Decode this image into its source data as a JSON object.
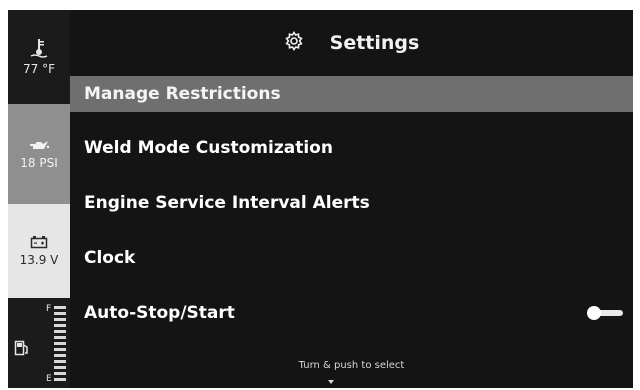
{
  "sidebar": {
    "temperature": {
      "icon": "temperature-gauge-icon",
      "value": "77 °F"
    },
    "oil_pressure": {
      "icon": "oil-can-icon",
      "value": "18 PSI"
    },
    "battery": {
      "icon": "battery-icon",
      "value": "13.9 V"
    },
    "fuel": {
      "icon": "fuel-pump-icon",
      "full_label": "F",
      "empty_label": "E"
    }
  },
  "header": {
    "icon": "gear-icon",
    "title": "Settings"
  },
  "menu": {
    "items": [
      {
        "label": "Manage Restrictions",
        "selected": true
      },
      {
        "label": "Weld Mode Customization"
      },
      {
        "label": "Engine Service Interval Alerts"
      },
      {
        "label": "Clock"
      },
      {
        "label": "Auto-Stop/Start",
        "toggle": "off"
      }
    ]
  },
  "footer": {
    "hint": "Turn & push to select",
    "icon": "down-arrow-icon"
  }
}
